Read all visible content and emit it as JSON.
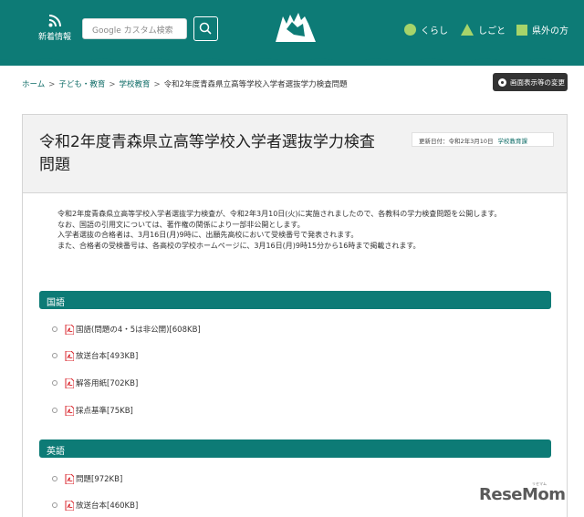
{
  "header": {
    "news_label": "新着情報",
    "search_placeholder": "Google カスタム検索",
    "nav": [
      {
        "label": "くらし",
        "icon": "circle-icon",
        "color": "#a6d46a"
      },
      {
        "label": "しごと",
        "icon": "triangle-icon",
        "color": "#a6d46a"
      },
      {
        "label": "県外の方",
        "icon": "square-icon",
        "color": "#a6d46a"
      }
    ]
  },
  "breadcrumb": [
    {
      "label": "ホーム",
      "link": true
    },
    {
      "label": "子ども・教育",
      "link": true
    },
    {
      "label": "学校教育",
      "link": true
    },
    {
      "label": "令和2年度青森県立高等学校入学者選抜学力検査問題",
      "link": false
    }
  ],
  "display_change_label": "画面表示等の変更",
  "page": {
    "title_line1": "令和2年度青森県立高等学校入学者選抜学力検査",
    "title_line2": "問題",
    "updated": "更新日付：令和2年3月10日",
    "department": "学校教育課",
    "intro": [
      "令和2年度青森県立高等学校入学者選抜学力検査が、令和2年3月10日(火)に実施されましたので、各教科の学力検査問題を公開します。",
      "なお、国語の引用文については、著作権の関係により一部非公開とします。",
      "入学者選抜の合格者は、3月16日(月)9時に、出願先高校において受検番号で発表されます。",
      "また、合格者の受検番号は、各高校の学校ホームページに、3月16日(月)9時15分から16時まで掲載されます。"
    ]
  },
  "sections": [
    {
      "title": "国語",
      "files": [
        "国語(問題の4・5は非公開)[608KB]",
        "放送台本[493KB]",
        "解答用紙[702KB]",
        "採点基準[75KB]"
      ]
    },
    {
      "title": "英語",
      "files": [
        "問題[972KB]",
        "放送台本[460KB]"
      ]
    }
  ],
  "watermark": {
    "text": "ReseMom",
    "sub": "リセマム"
  },
  "colors": {
    "brand": "#0d7b76",
    "accent": "#a6d46a",
    "pdf": "#d9262c"
  }
}
